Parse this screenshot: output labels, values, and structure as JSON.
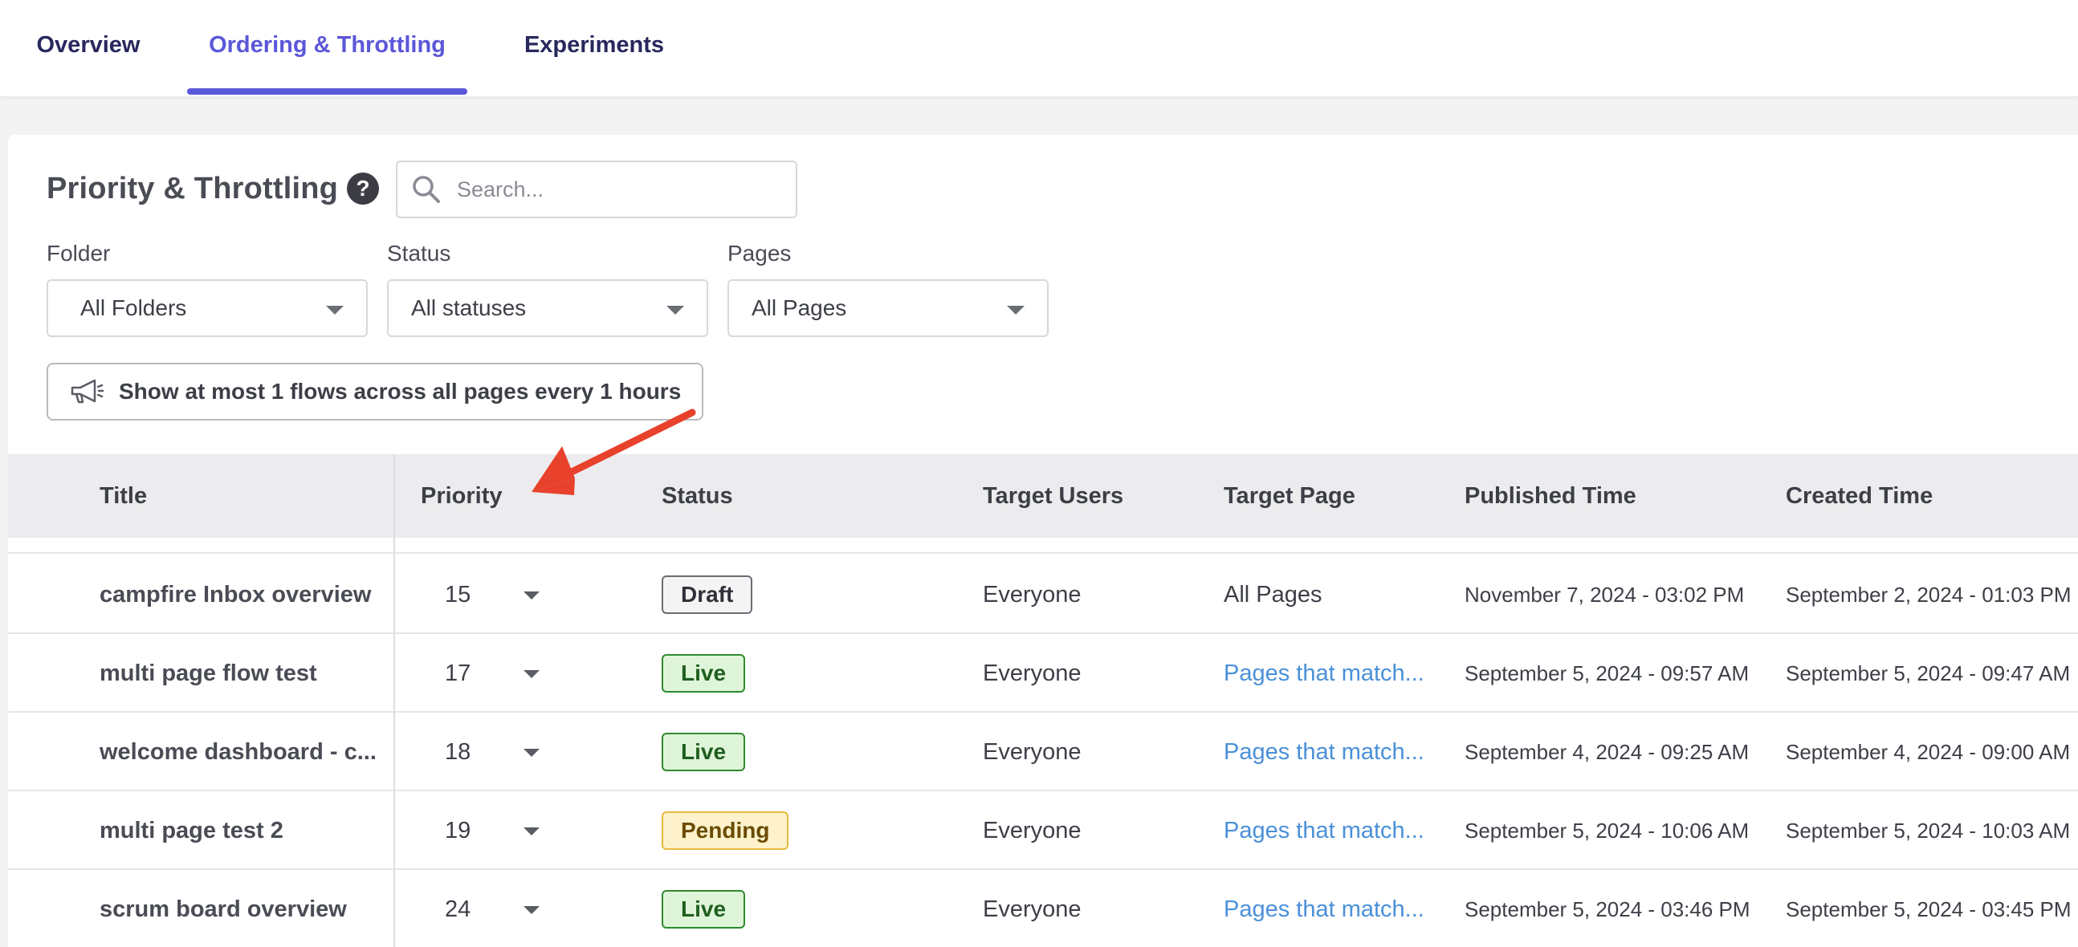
{
  "tabs": [
    {
      "label": "Overview"
    },
    {
      "label": "Ordering & Throttling"
    },
    {
      "label": "Experiments"
    }
  ],
  "active_tab": "Ordering & Throttling",
  "accent_color": "#5b57d9",
  "header": {
    "title": "Priority & Throttling",
    "help_icon": "?",
    "search_placeholder": "Search..."
  },
  "filters": {
    "folder": {
      "label": "Folder",
      "value": "All Folders"
    },
    "status": {
      "label": "Status",
      "value": "All statuses"
    },
    "pages": {
      "label": "Pages",
      "value": "All Pages"
    }
  },
  "throttle_button": {
    "icon": "megaphone-icon",
    "label": "Show at most 1 flows across all pages every 1 hours"
  },
  "table": {
    "columns": [
      "Title",
      "Priority",
      "Status",
      "Target Users",
      "Target Page",
      "Published Time",
      "Created Time"
    ],
    "rows": [
      {
        "title": "campfire Inbox overview",
        "priority": "15",
        "status": "Draft",
        "status_kind": "draft",
        "target_users": "Everyone",
        "target_page": "All Pages",
        "published": "November 7, 2024 - 03:02 PM",
        "created": "September 2, 2024 - 01:03 PM"
      },
      {
        "title": "multi page flow test",
        "priority": "17",
        "status": "Live",
        "status_kind": "live",
        "target_users": "Everyone",
        "target_page": "Pages that match...",
        "published": "September 5, 2024 - 09:57 AM",
        "created": "September 5, 2024 - 09:47 AM"
      },
      {
        "title": "welcome dashboard - c...",
        "priority": "18",
        "status": "Live",
        "status_kind": "live",
        "target_users": "Everyone",
        "target_page": "Pages that match...",
        "published": "September 4, 2024 - 09:25 AM",
        "created": "September 4, 2024 - 09:00 AM"
      },
      {
        "title": "multi page test 2",
        "priority": "19",
        "status": "Pending",
        "status_kind": "pending",
        "target_users": "Everyone",
        "target_page": "Pages that match...",
        "published": "September 5, 2024 - 10:06 AM",
        "created": "September 5, 2024 - 10:03 AM"
      },
      {
        "title": "scrum board overview",
        "priority": "24",
        "status": "Live",
        "status_kind": "live",
        "target_users": "Everyone",
        "target_page": "Pages that match...",
        "published": "September 5, 2024 - 03:46 PM",
        "created": "September 5, 2024 - 03:45 PM"
      }
    ]
  },
  "status_colors": {
    "draft": "#6b6d75",
    "live": "#2f8a2f",
    "pending": "#e7b93f"
  },
  "annotation_arrow_color": "#e8412c"
}
